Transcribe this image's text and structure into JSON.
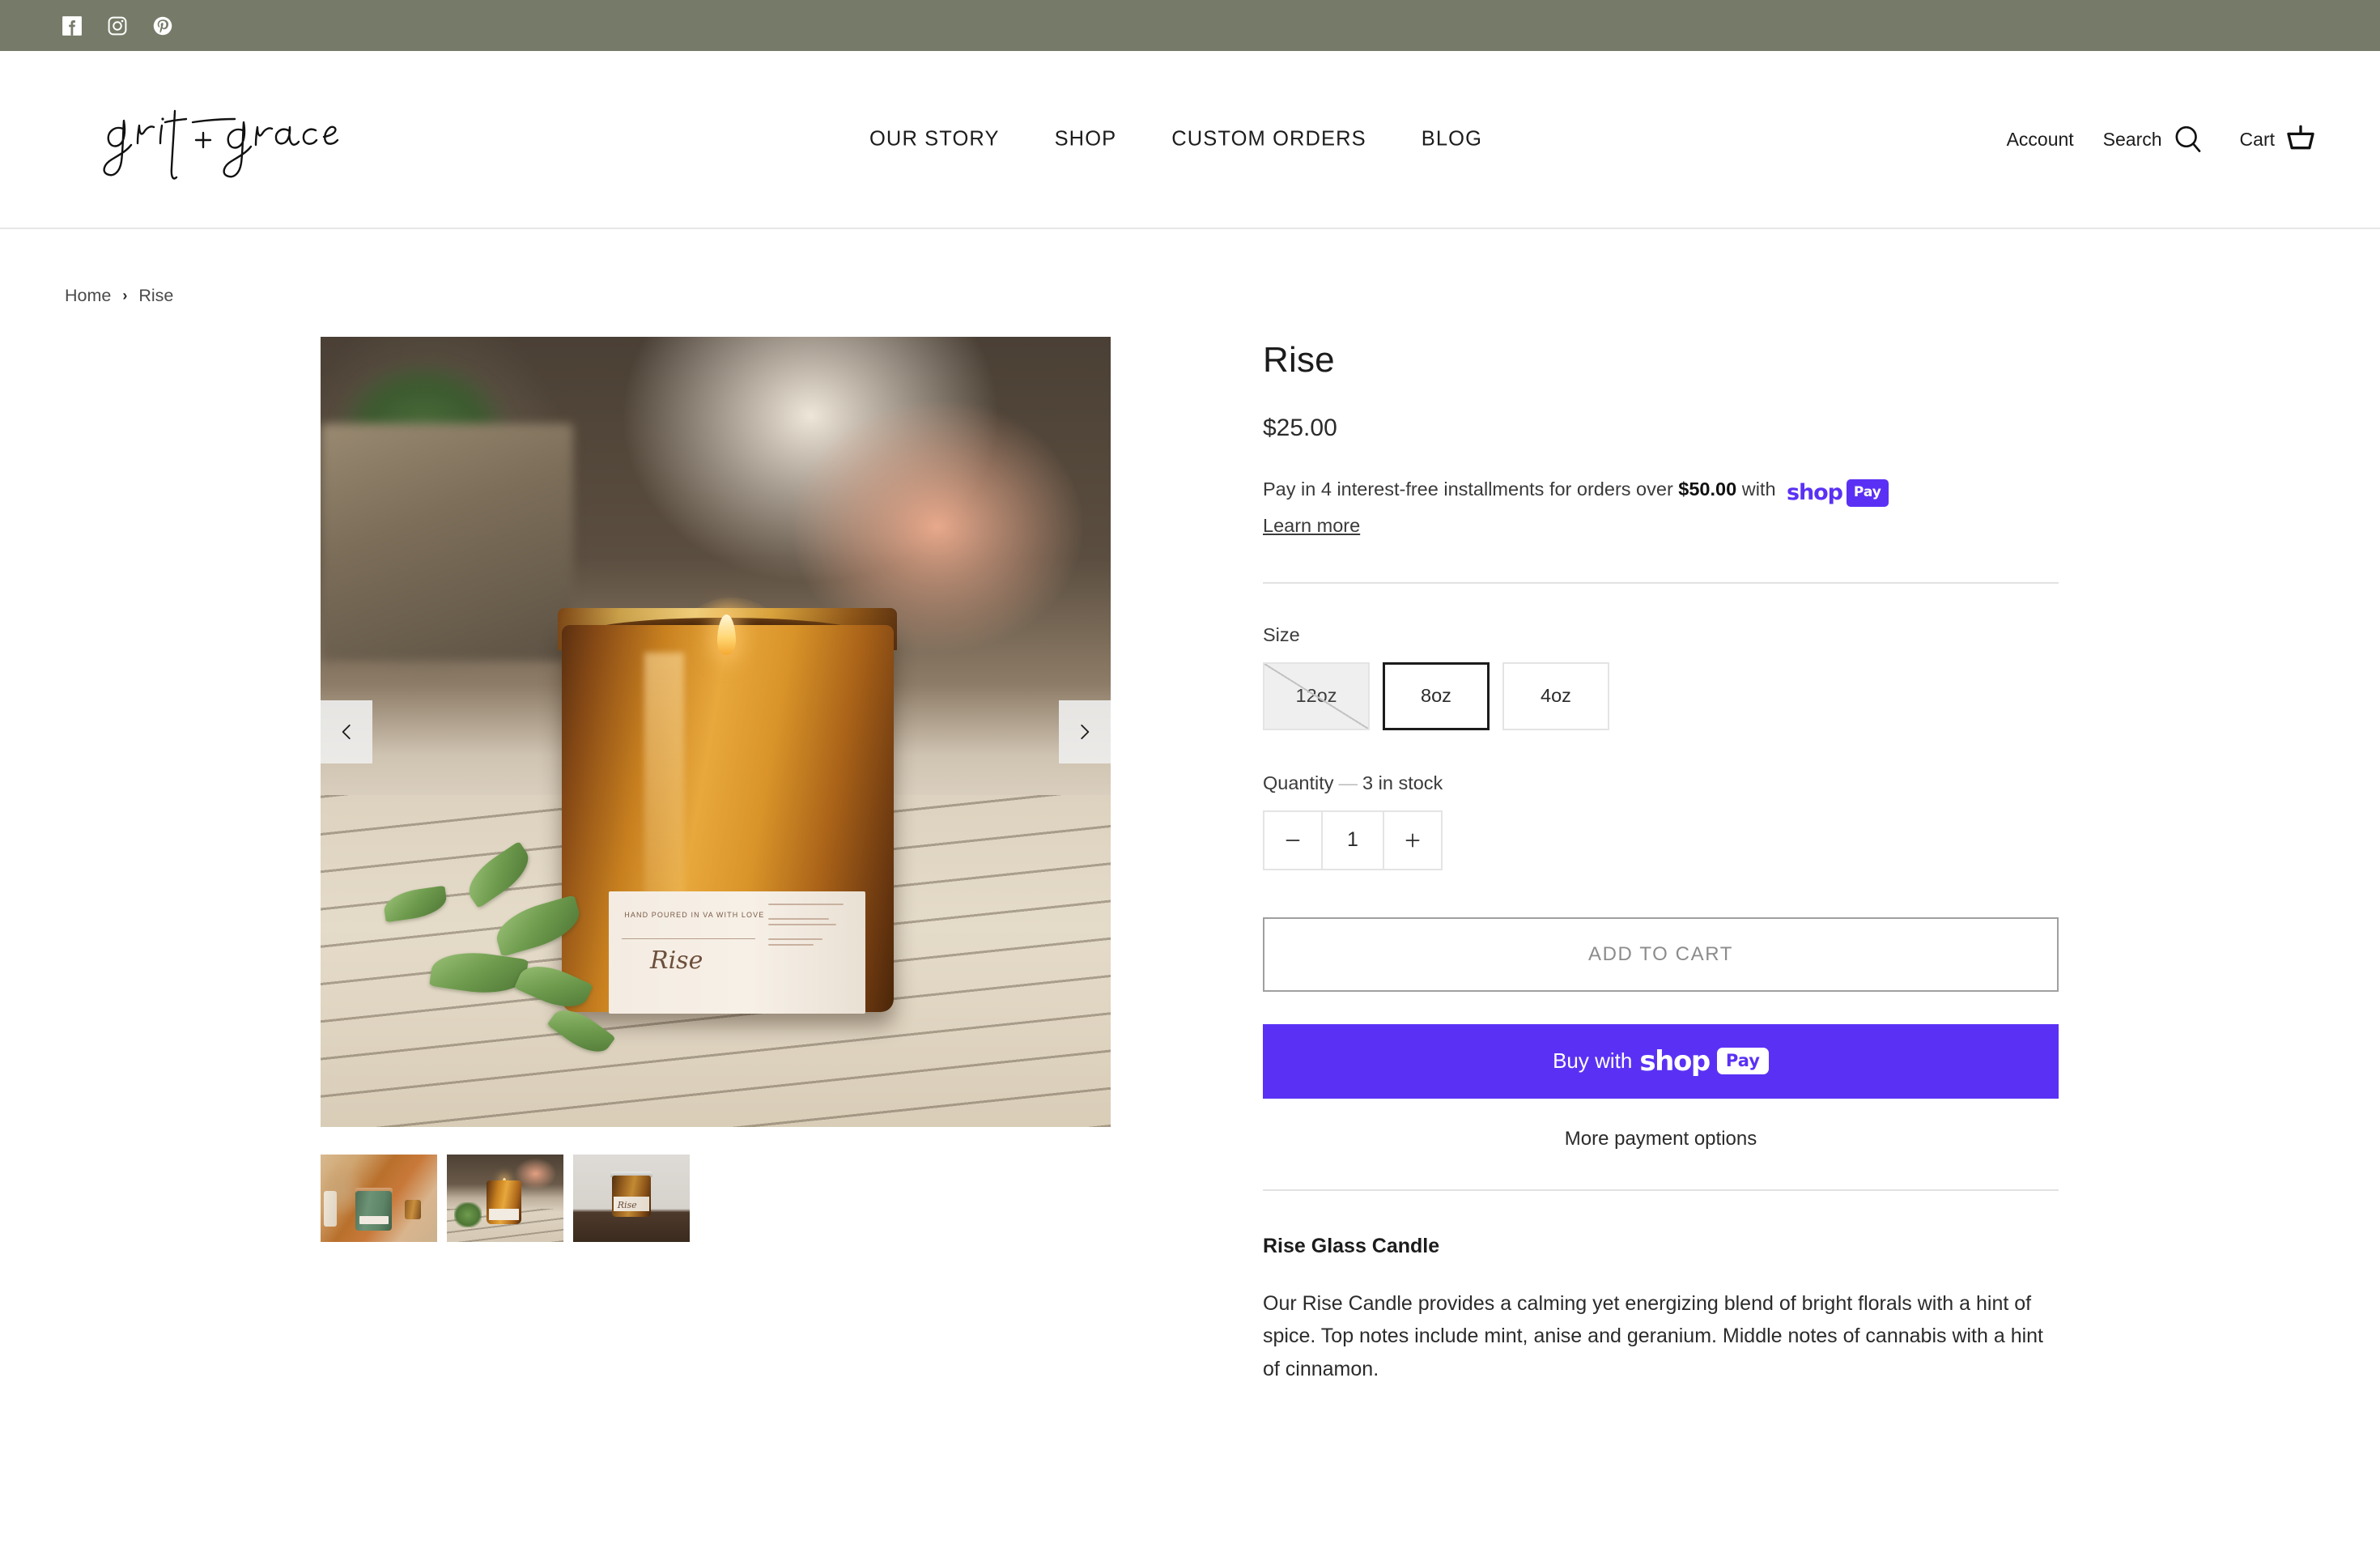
{
  "social_bar": {
    "icons": [
      {
        "name": "facebook-icon",
        "label": "Facebook"
      },
      {
        "name": "instagram-icon",
        "label": "Instagram"
      },
      {
        "name": "pinterest-icon",
        "label": "Pinterest"
      }
    ],
    "background_color": "#767b69"
  },
  "header": {
    "logo_text": "grit + grace",
    "nav": [
      {
        "label": "OUR STORY"
      },
      {
        "label": "SHOP"
      },
      {
        "label": "CUSTOM ORDERS"
      },
      {
        "label": "BLOG"
      }
    ],
    "actions": {
      "account_label": "Account",
      "search_label": "Search",
      "search_icon": "search-icon",
      "cart_label": "Cart",
      "cart_icon": "cart-basket-icon"
    }
  },
  "breadcrumb": {
    "home": "Home",
    "separator": "›",
    "current": "Rise"
  },
  "gallery": {
    "prev_arrow": "‹",
    "next_arrow": "›",
    "main_image_alt": "Rise amber glass candle lit on striped linen with greenery",
    "main_label_top_text": "HAND POURED IN VA WITH LOVE",
    "main_label_name": "Rise",
    "thumbnails": [
      {
        "alt": "Two people holding green ceramic Rise candles"
      },
      {
        "alt": "Lit amber Rise candle with greenery"
      },
      {
        "alt": "Capped amber Rise candle on dark wood"
      }
    ],
    "thumb3_label": "Rise"
  },
  "product": {
    "title": "Rise",
    "price": "$25.00",
    "installments_prefix": "Pay in 4 interest-free installments for orders over",
    "installments_amount": "$50.00",
    "installments_with": "with",
    "shop_word": "shop",
    "pay_badge": "Pay",
    "learn_more": "Learn more",
    "size_label": "Size",
    "sizes": [
      {
        "label": "12oz",
        "state": "unavailable"
      },
      {
        "label": "8oz",
        "state": "selected"
      },
      {
        "label": "4oz",
        "state": "available"
      }
    ],
    "quantity_label": "Quantity",
    "quantity_dash": "—",
    "stock_text": "3 in stock",
    "qty_decrease": "—",
    "qty_value": "1",
    "qty_increase": "+",
    "add_to_cart_label": "ADD TO CART",
    "buy_with_prefix": "Buy with",
    "shoppay_button_shop": "shop",
    "shoppay_button_pay": "Pay",
    "more_payment_options": "More payment options",
    "description_heading": "Rise Glass Candle",
    "description_body": "Our Rise Candle provides a calming yet energizing blend of bright florals with a hint of spice. Top notes include mint, anise and geranium. Middle notes of cannabis with a hint of cinnamon.",
    "shoppay_purple": "#5A31F4"
  }
}
